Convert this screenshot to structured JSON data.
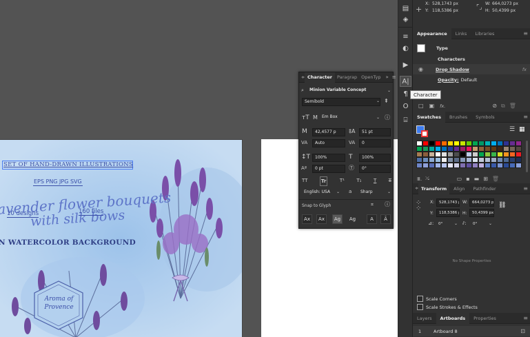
{
  "canvas": {
    "art_title": "SET OF HAND-DRAWN ILLUSTRATIONS",
    "art_formats": "EPS PNG JPG SVG",
    "art_script_1": "avender flower bouquets",
    "art_script_2": "with silk bows",
    "badge_designs": "10 designs",
    "badge_files": "160 files",
    "art_subtitle": "N WATERCOLOR BACKGROUND",
    "hex_text": "Aroma of Provence"
  },
  "infobar": {
    "x_label": "X:",
    "x_value": "528,1743 px",
    "y_label": "Y:",
    "y_value": "118,5386 px",
    "w_label": "W:",
    "w_value": "664,0273 px",
    "h_label": "H:",
    "h_value": "50,4399 px"
  },
  "tooltip": {
    "text": "Character"
  },
  "appearance": {
    "tabs": [
      "Appearance",
      "Links",
      "Libraries"
    ],
    "type_label": "Type",
    "characters_label": "Characters",
    "drop_shadow_label": "Drop Shadow",
    "fx_label": "fx",
    "opacity_label": "Opacity:",
    "opacity_value": "Default"
  },
  "character": {
    "tabs": [
      "Character",
      "Paragrap",
      "OpenTyp"
    ],
    "more": "»",
    "font_family": "Minion Variable Concept",
    "font_style": "Semibold",
    "em_box": "Em Box",
    "font_size": "42,4577 p",
    "leading": "51 pt",
    "kerning": "Auto",
    "tracking": "0",
    "vscale": "100%",
    "hscale": "100%",
    "baseline": "0 pt",
    "rotation": "0°",
    "language": "English: USA",
    "antialias": "Sharp",
    "aa_label": "a",
    "snap_label": "Snap to Glyph",
    "caps_btns": [
      "TT",
      "Tr",
      "T¹",
      "T₁",
      "T",
      "T"
    ],
    "glyph_btns": [
      "Ax",
      "Ax",
      "Ag",
      "Ag",
      "A",
      "Ā"
    ]
  },
  "swatches": {
    "tabs": [
      "Swatches",
      "Brushes",
      "Symbols"
    ],
    "colors": [
      "#ffffff",
      "#ff0000",
      "#000000",
      "#ff0000",
      "#ff6a00",
      "#ffd500",
      "#ffff00",
      "#c8e600",
      "#66cc00",
      "#00a651",
      "#009966",
      "#00b3b3",
      "#00aeef",
      "#0072bc",
      "#2e3192",
      "#662d91",
      "#92278f",
      "#00a651",
      "#1a9b5a",
      "#00a99d",
      "#00aeef",
      "#0072bc",
      "#21409a",
      "#662d91",
      "#9e1f63",
      "#ed145b",
      "#c69c6d",
      "#8c6239",
      "#754c24",
      "#603913",
      "#3c2415",
      "#998675",
      "#736357",
      "#534741",
      "#a67c52",
      "#8b5e3c",
      "#c7b299",
      "#ffffff",
      "#e0e0e0",
      "#9e9e9e",
      "#4d4d4d",
      "#000000",
      "#bdcce8",
      "#cccccc",
      "#00a651",
      "#8dc63f",
      "#39b54a",
      "#d7df23",
      "#f7941d",
      "#f26522",
      "#ed1c24",
      "#4d6fa6",
      "#6d8ebd",
      "#8eacd4",
      "#9bbfe0",
      "#f0f0f0",
      "#7f8fa6",
      "#5b6b86",
      "#8799b8",
      "#a8b8d4",
      "#dde5f0",
      "#c0c8d8",
      "#b2bfd6",
      "#a0aec8",
      "#708ab0",
      "#4f6a95",
      "#2a3f6e",
      "#1e2d52",
      "#6f86c8",
      "#8ea0d8",
      "#5a6fb8",
      "#9fb4e8",
      "#b6c4ee",
      "#e8e8f8",
      "#d0d0e8",
      "#8070b0",
      "#6050a0",
      "#9080c0",
      "#c0b0e0",
      "#5e7fc6",
      "#3a5aa8",
      "#7b94d2",
      "#2b4a94",
      "#476ab8",
      "#8aa0dc"
    ]
  },
  "transform": {
    "tabs": [
      "Transform",
      "Align",
      "Pathfinder"
    ],
    "x_label": "X:",
    "x_value": "528,1743 px",
    "y_label": "Y:",
    "y_value": "118,5386 px",
    "w_label": "W:",
    "w_value": "664,0273 px",
    "h_label": "H:",
    "h_value": "50,4399 px",
    "angle_value": "0°",
    "shear_value": "0°",
    "no_shape": "No Shape Properties",
    "scale_corners": "Scale Corners",
    "scale_strokes": "Scale Strokes & Effects"
  },
  "layers": {
    "tabs": [
      "Layers",
      "Artboards",
      "Properties"
    ],
    "artboard_num": "1",
    "artboard_name": "Artboard 8"
  }
}
